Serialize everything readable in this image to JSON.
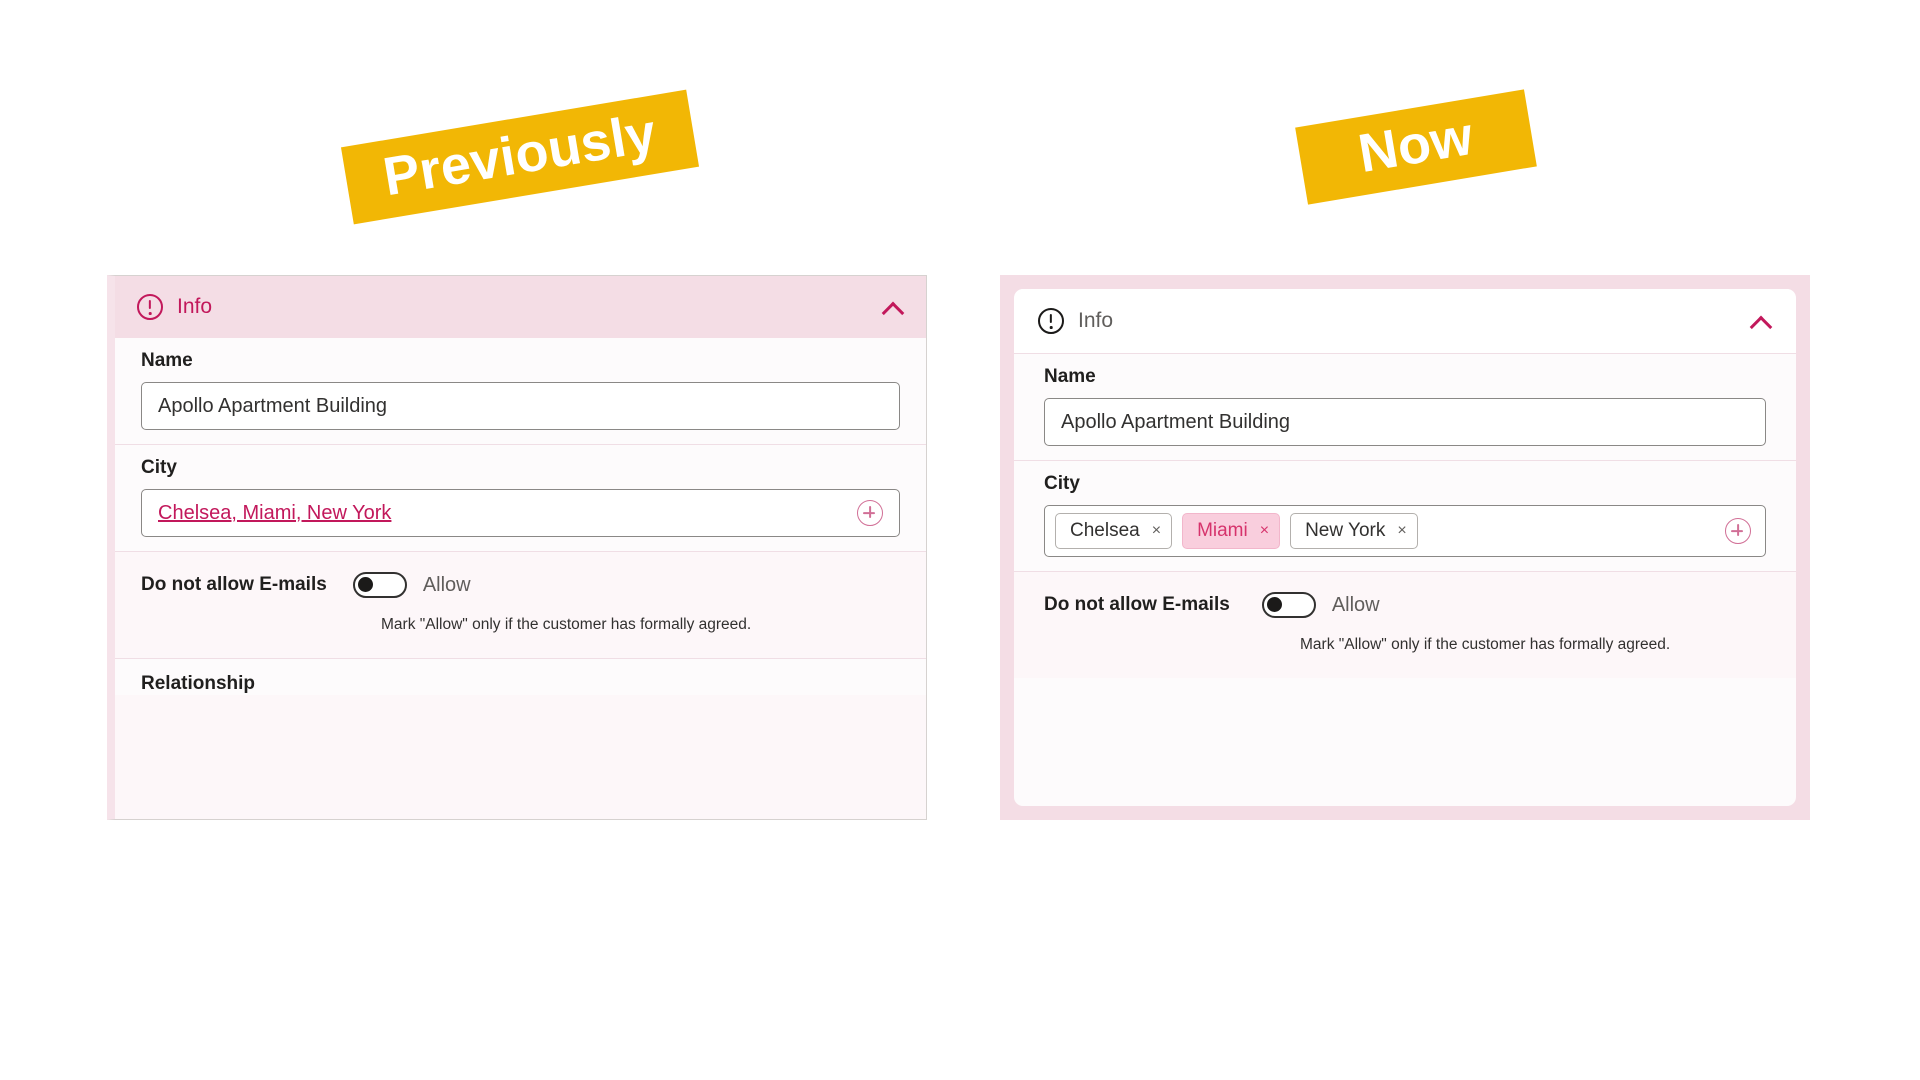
{
  "banners": {
    "previously": "Previously",
    "now": "Now",
    "color": "#f2b705"
  },
  "previously_panel": {
    "header": {
      "icon": "info-circle-icon",
      "title": "Info",
      "collapse_icon": "chevron-up-icon",
      "accent_color": "#c2185b"
    },
    "fields": {
      "name_label": "Name",
      "name_value": "Apollo Apartment Building",
      "city_label": "City",
      "city_value": "Chelsea, Miami, New York",
      "city_add_icon": "plus-circle-icon",
      "email_label": "Do not allow E-mails",
      "email_toggle_state": "off",
      "email_toggle_text": "Allow",
      "email_hint": "Mark \"Allow\" only if the customer has formally agreed.",
      "relationship_label": "Relationship"
    }
  },
  "now_panel": {
    "header": {
      "icon": "info-circle-icon",
      "title": "Info",
      "collapse_icon": "chevron-up-icon",
      "accent_color": "#c2185b"
    },
    "fields": {
      "name_label": "Name",
      "name_value": "Apollo Apartment Building",
      "city_label": "City",
      "city_chips": [
        {
          "label": "Chelsea",
          "remove": "×",
          "selected": false
        },
        {
          "label": "Miami",
          "remove": "×",
          "selected": true
        },
        {
          "label": "New York",
          "remove": "×",
          "selected": false
        }
      ],
      "city_add_icon": "plus-circle-icon",
      "email_label": "Do not allow E-mails",
      "email_toggle_state": "off",
      "email_toggle_text": "Allow",
      "email_hint": "Mark \"Allow\" only if the customer has formally agreed."
    }
  }
}
